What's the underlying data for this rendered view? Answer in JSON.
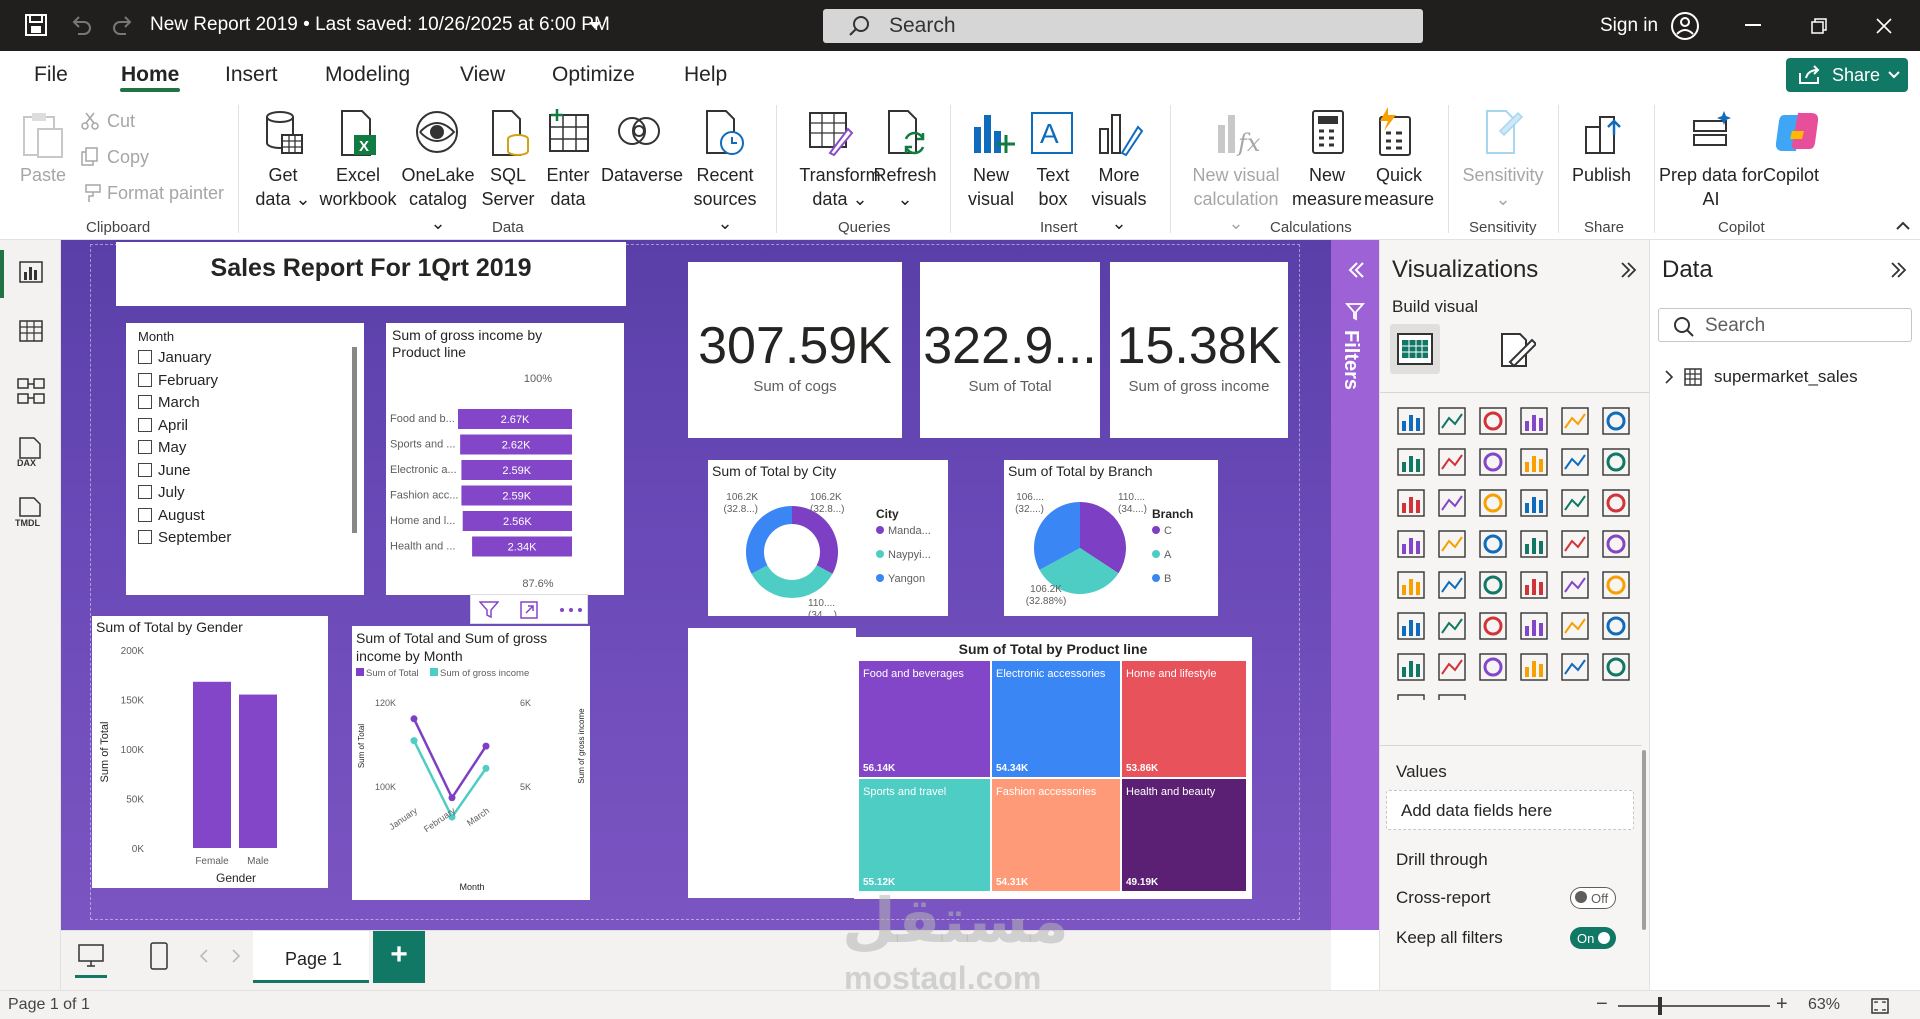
{
  "titlebar": {
    "title": "New Report 2019 • Last saved: 10/26/2025 at 6:00 PM",
    "search": "Search",
    "signin": "Sign in"
  },
  "menu": [
    "File",
    "Home",
    "Insert",
    "Modeling",
    "View",
    "Optimize",
    "Help"
  ],
  "share": "Share",
  "ribbon": {
    "clipboard": {
      "paste": "Paste",
      "cut": "Cut",
      "copy": "Copy",
      "format_painter": "Format painter",
      "group": "Clipboard"
    },
    "data": {
      "get_data": [
        "Get",
        "data"
      ],
      "excel": [
        "Excel",
        "workbook"
      ],
      "onelake": [
        "OneLake",
        "catalog"
      ],
      "sql": [
        "SQL",
        "Server"
      ],
      "enter": [
        "Enter",
        "data"
      ],
      "dataverse": "Dataverse",
      "recent": [
        "Recent",
        "sources"
      ],
      "group": "Data"
    },
    "queries": {
      "transform": [
        "Transform",
        "data"
      ],
      "refresh": "Refresh",
      "group": "Queries"
    },
    "insert": {
      "new_visual": [
        "New",
        "visual"
      ],
      "text_box": [
        "Text",
        "box"
      ],
      "more_visuals": [
        "More",
        "visuals"
      ],
      "group": "Insert"
    },
    "calculations": {
      "new_visual_calc": [
        "New visual",
        "calculation"
      ],
      "new_measure": [
        "New",
        "measure"
      ],
      "quick_measure": [
        "Quick",
        "measure"
      ],
      "group": "Calculations"
    },
    "sensitivity": {
      "label": "Sensitivity",
      "group": "Sensitivity"
    },
    "share": {
      "publish": "Publish",
      "group": "Share"
    },
    "copilot": {
      "prep": [
        "Prep data for",
        "AI"
      ],
      "copilot": "Copilot",
      "group": "Copilot"
    }
  },
  "report": {
    "title": "Sales Report For 1Qrt 2019",
    "slicer": {
      "header": "Month",
      "items": [
        "January",
        "February",
        "March",
        "April",
        "May",
        "June",
        "July",
        "August",
        "September"
      ]
    },
    "kpis": [
      {
        "value": "307.59K",
        "label": "Sum of cogs"
      },
      {
        "value": "322.9...",
        "label": "Sum of Total"
      },
      {
        "value": "15.38K",
        "label": "Sum of gross income"
      }
    ]
  },
  "chart_data": [
    {
      "type": "bar",
      "title": "Sum of gross income by Product line",
      "categories": [
        "Food and b...",
        "Sports and ...",
        "Electronic a...",
        "Fashion acc...",
        "Home and l...",
        "Health and ..."
      ],
      "values": [
        2.67,
        2.62,
        2.59,
        2.59,
        2.56,
        2.34
      ],
      "value_labels": [
        "2.67K",
        "2.62K",
        "2.59K",
        "2.59K",
        "2.56K",
        "2.34K"
      ],
      "top_label": "100%",
      "bottom_label": "87.6%",
      "color": "#8446c8"
    },
    {
      "type": "pie",
      "title": "Sum of Total by City",
      "legend_title": "City",
      "legend": [
        "Manda...",
        "Naypyi...",
        "Yangon"
      ],
      "values": [
        106.2,
        110.6,
        106.2
      ],
      "labels": [
        "106.2K (32.8...)",
        "106.2K (32.8...)",
        "110.... (34....)"
      ],
      "colors": [
        "#7d3fc4",
        "#4ecdc4",
        "#3a86f5"
      ],
      "donut": true
    },
    {
      "type": "pie",
      "title": "Sum of Total by Branch",
      "legend_title": "Branch",
      "legend": [
        "C",
        "A",
        "B"
      ],
      "values": [
        110.6,
        106.2,
        106.2
      ],
      "labels": [
        "106.... (32....)",
        "110.... (34....)",
        "106.2K (32.88%)"
      ],
      "colors": [
        "#7d3fc4",
        "#4ecdc4",
        "#3a86f5"
      ],
      "donut": false
    },
    {
      "type": "bar",
      "title": "Sum of Total by Gender",
      "categories": [
        "Female",
        "Male"
      ],
      "values": [
        167.9,
        155
      ],
      "xlabel": "Gender",
      "ylabel": "Sum of Total",
      "ylim": [
        0,
        200
      ],
      "yticks": [
        "0K",
        "50K",
        "100K",
        "150K",
        "200K"
      ],
      "color": "#8446c8"
    },
    {
      "type": "line",
      "title": "Sum of Total and Sum of gross income by Month",
      "categories": [
        "January",
        "February",
        "March"
      ],
      "series": [
        {
          "name": "Sum of Total",
          "values": [
            116,
            97.2,
            109.5
          ],
          "color": "#7d3fc4"
        },
        {
          "name": "Sum of gross income",
          "values": [
            5.54,
            4.63,
            5.21
          ],
          "color": "#4ecdc4"
        }
      ],
      "xlabel": "Month",
      "ylabel": "Sum of Total",
      "y2label": "Sum of gross income",
      "yticks": [
        "100K",
        "120K"
      ],
      "y2ticks": [
        "5K",
        "6K"
      ]
    },
    {
      "type": "treemap",
      "title": "Sum of Total by Product line",
      "categories": [
        "Food and beverages",
        "Electronic accessories",
        "Home and lifestyle",
        "Sports and travel",
        "Fashion accessories",
        "Health and beauty"
      ],
      "value_labels": [
        "56.14K",
        "54.34K",
        "53.86K",
        "55.12K",
        "54.31K",
        "49.19K"
      ],
      "colors": [
        "#8446c8",
        "#3a86f5",
        "#e8525a",
        "#4ecdc4",
        "#ff9a78",
        "#5b1f73"
      ]
    }
  ],
  "filters": {
    "label": "Filters"
  },
  "viz": {
    "title": "Visualizations",
    "build": "Build visual",
    "values": "Values",
    "add_fields": "Add data fields here",
    "drill": "Drill through",
    "cross": "Cross-report",
    "cross_state": "Off",
    "keep": "Keep all filters",
    "keep_state": "On"
  },
  "data": {
    "title": "Data",
    "search": "Search",
    "table": "supermarket_sales"
  },
  "pages": {
    "tab": "Page 1",
    "add": "+"
  },
  "status": {
    "page": "Page 1 of 1",
    "zoom": "63%"
  },
  "watermark": {
    "arabic": "مستقل",
    "latin": "mostaql.com"
  }
}
